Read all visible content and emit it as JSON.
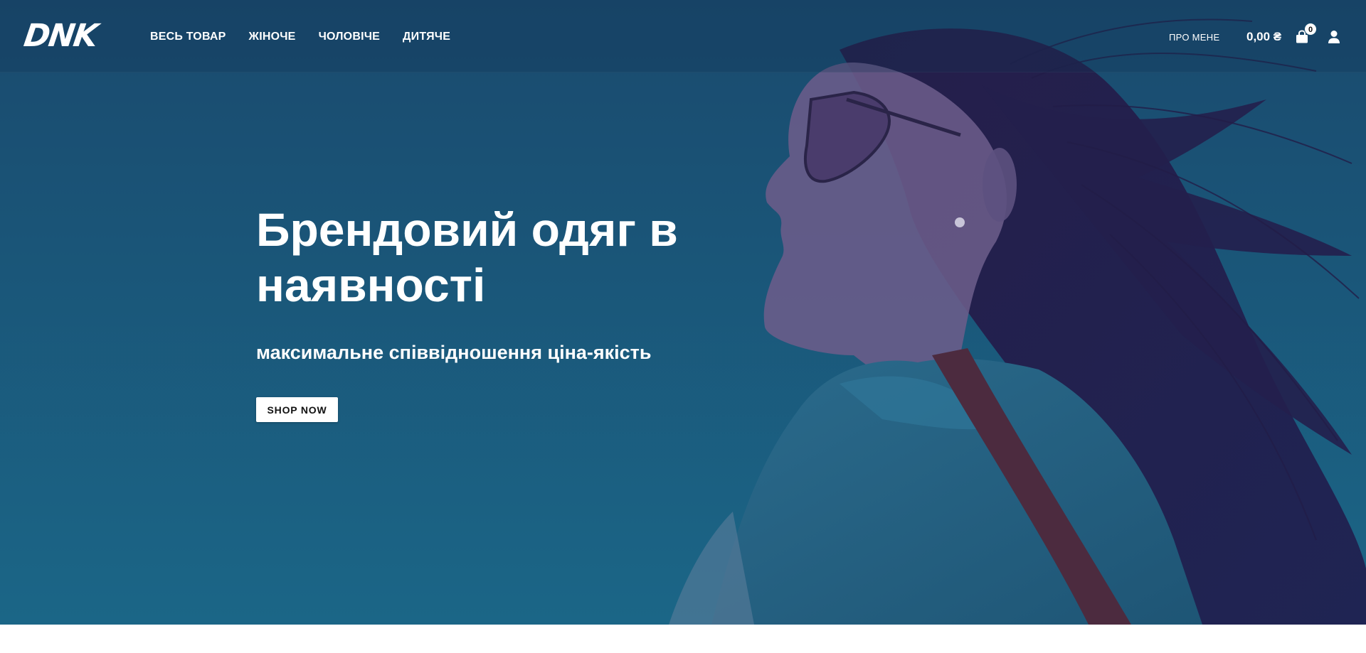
{
  "header": {
    "logo_text": "DNK",
    "nav": [
      {
        "label": "ВЕСЬ ТОВАР"
      },
      {
        "label": "ЖІНОЧЕ"
      },
      {
        "label": "ЧОЛОВІЧЕ"
      },
      {
        "label": "ДИТЯЧЕ"
      }
    ],
    "about_label": "ПРО МЕНЕ",
    "cart_amount": "0,00 ₴",
    "cart_count": "0",
    "cart_icon": "shopping-bag-icon",
    "account_icon": "user-icon"
  },
  "hero": {
    "title": "Брендовий одяг в наявності",
    "subtitle": "максимальне співвідношення ціна-якість",
    "cta_label": "SHOP NOW",
    "image": "woman-in-sunglasses-denim-jacket-photo"
  },
  "colors": {
    "hero_background": "#1a5677",
    "text": "#ffffff",
    "button_background": "#ffffff",
    "button_text": "#111111"
  }
}
